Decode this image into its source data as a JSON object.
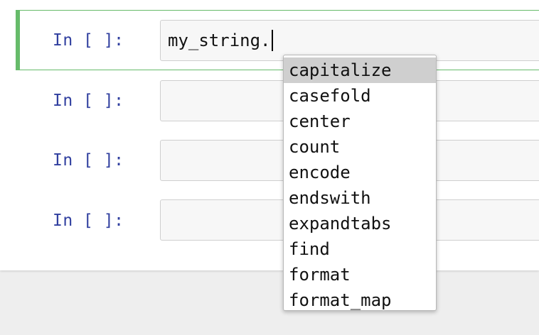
{
  "cells": [
    {
      "prompt": "In [ ]:",
      "code": "my_string.",
      "selected": true
    },
    {
      "prompt": "In [ ]:",
      "code": ""
    },
    {
      "prompt": "In [ ]:",
      "code": ""
    },
    {
      "prompt": "In [ ]:",
      "code": ""
    }
  ],
  "completer": {
    "items": [
      "capitalize",
      "casefold",
      "center",
      "count",
      "encode",
      "endswith",
      "expandtabs",
      "find",
      "format",
      "format_map"
    ],
    "active_item": "capitalize"
  },
  "colors": {
    "selected_border": "#66bb6a",
    "prompt": "#303f9f",
    "input_bg": "#f7f7f7",
    "highlight": "#cfcfcf"
  }
}
